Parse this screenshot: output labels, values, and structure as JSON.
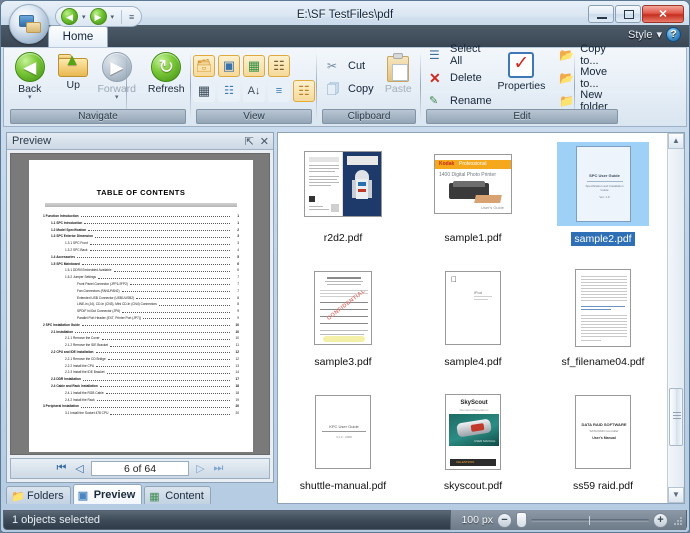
{
  "window": {
    "title": "E:\\SF TestFiles\\pdf",
    "minimize_label": "–",
    "maximize_label": "☐",
    "close_label": "✕"
  },
  "quick_access": {
    "back_icon": "back-arrow-icon",
    "forward_icon": "forward-arrow-icon",
    "dropdown_glyph": "▾",
    "more_glyph": "≡"
  },
  "ribbon": {
    "tab_label": "Home",
    "style_label": "Style",
    "style_caret": "▾",
    "help_label": "?",
    "groups": [
      {
        "name": "Navigate",
        "title": "Navigate",
        "buttons": [
          {
            "label": "Back",
            "icon": "back-arrow-icon",
            "glyph": "◀",
            "caret": "▾",
            "enabled": true
          },
          {
            "label": "Up",
            "icon": "folder-up-icon",
            "glyph": "▲",
            "caret": "",
            "enabled": true
          },
          {
            "label": "Forward",
            "icon": "forward-arrow-icon",
            "glyph": "▶",
            "caret": "▾",
            "enabled": false
          },
          {
            "label": "Refresh",
            "icon": "refresh-icon",
            "glyph": "↻",
            "caret": "",
            "enabled": true
          }
        ]
      },
      {
        "name": "View",
        "title": "View",
        "row1": [
          "view-filmstrip-icon",
          "view-thumbnails-icon",
          "view-tiles-icon",
          "view-details-grid-icon"
        ],
        "row2": [
          "view-table-icon",
          "view-list-icon",
          "view-sort-icon",
          "view-group-icon",
          "view-large-icons-icon"
        ]
      },
      {
        "name": "Clipboard",
        "title": "Clipboard",
        "cut_label": "Cut",
        "copy_label": "Copy",
        "paste_label": "Paste",
        "paste_enabled": false
      },
      {
        "name": "Edit",
        "title": "Edit",
        "select_all_label": "Select All",
        "delete_label": "Delete",
        "rename_label": "Rename",
        "properties_label": "Properties",
        "copy_to_label": "Copy to...",
        "move_to_label": "Move to...",
        "new_folder_label": "New folder"
      }
    ]
  },
  "preview": {
    "title": "Preview",
    "pin_glyph": "⇱",
    "close_glyph": "✕",
    "page_indicator": "6 of 64",
    "first_glyph": "⏮",
    "prev_glyph": "◁",
    "next_glyph": "▷",
    "last_glyph": "⏭",
    "document": {
      "heading": "TABLE OF CONTENTS",
      "entries": [
        {
          "level": 1,
          "text": "1 Function Introduction",
          "page": "1"
        },
        {
          "level": 2,
          "text": "1.1 SPC Introduction",
          "page": "1"
        },
        {
          "level": 2,
          "text": "1.2 Model Specification",
          "page": "2"
        },
        {
          "level": 2,
          "text": "1.3 SPC Exterior Dimension",
          "page": "3"
        },
        {
          "level": 3,
          "text": "1.3.1 SPC Front",
          "page": "3"
        },
        {
          "level": 3,
          "text": "1.3.2 SPC Back",
          "page": "4"
        },
        {
          "level": 2,
          "text": "1.4 Accessories",
          "page": "5"
        },
        {
          "level": 2,
          "text": "1.5 SPC Mainboard",
          "page": "6"
        },
        {
          "level": 3,
          "text": "1.5.1 DDRII Embedded Available",
          "page": "6"
        },
        {
          "level": 3,
          "text": "1.5.2 Jumper Settings",
          "page": "7"
        },
        {
          "level": 4,
          "text": "Front Panel Connector (JFP1/JFP2)",
          "page": "7"
        },
        {
          "level": 4,
          "text": "Fan Connectors (FAN1/FAN2)",
          "page": "7"
        },
        {
          "level": 4,
          "text": "Extended USB Connector (USB1/USB2)",
          "page": "8"
        },
        {
          "level": 4,
          "text": "LINE-in (J4), CD-In (CN3), Mini CD-In (CN4) Connectors",
          "page": "8"
        },
        {
          "level": 4,
          "text": "SPDIF In/Out Connector (JP6)",
          "page": "9"
        },
        {
          "level": 4,
          "text": "Parallel Port Header (EXT. Printer Port (JP7))",
          "page": "9"
        },
        {
          "level": 1,
          "text": "2 SPC Installation Guide",
          "page": "10"
        },
        {
          "level": 2,
          "text": "2.1 Installation",
          "page": "10"
        },
        {
          "level": 3,
          "text": "2.1.1 Remove the Cover",
          "page": "10"
        },
        {
          "level": 3,
          "text": "2.1.2 Remove the IDE Bracket",
          "page": "11"
        },
        {
          "level": 2,
          "text": "2.2 CPU and IDE Installation",
          "page": "12"
        },
        {
          "level": 3,
          "text": "2.2.1 Remove the CD Bridge",
          "page": "12"
        },
        {
          "level": 3,
          "text": "2.2.2 Install the CPU",
          "page": "13"
        },
        {
          "level": 3,
          "text": "2.2.3 Install the IDE Bracket",
          "page": "14"
        },
        {
          "level": 2,
          "text": "2.3 DDR Installation",
          "page": "17"
        },
        {
          "level": 2,
          "text": "2.4 Cable and Rack Installation",
          "page": "18"
        },
        {
          "level": 3,
          "text": "2.4.1 Install the RGB Cable",
          "page": "18"
        },
        {
          "level": 3,
          "text": "2.4.2 Install the Rack",
          "page": "19"
        },
        {
          "level": 1,
          "text": "3 Peripheral Installation",
          "page": "20"
        },
        {
          "level": 3,
          "text": "3.1 Install the Socket 478 CPU",
          "page": "20"
        }
      ]
    }
  },
  "left_tabs": [
    {
      "label": "Folders",
      "icon": "folders-icon",
      "active": false
    },
    {
      "label": "Preview",
      "icon": "preview-icon",
      "active": true
    },
    {
      "label": "Content",
      "icon": "content-icon",
      "active": false
    }
  ],
  "files": [
    {
      "name": "r2d2.pdf",
      "thumb": "r2d2-poster",
      "selected": false
    },
    {
      "name": "sample1.pdf",
      "thumb": "kodak-printer",
      "selected": false
    },
    {
      "name": "sample2.pdf",
      "thumb": "blue-user-guide",
      "selected": true
    },
    {
      "name": "sample3.pdf",
      "thumb": "confidential-form",
      "selected": false
    },
    {
      "name": "sample4.pdf",
      "thumb": "apple-blank",
      "selected": false
    },
    {
      "name": "sf_filename04.pdf",
      "thumb": "text-document",
      "selected": false
    },
    {
      "name": "shuttle-manual.pdf",
      "thumb": "shuttle-cover",
      "selected": false
    },
    {
      "name": "skyscout.pdf",
      "thumb": "skyscout-cover",
      "selected": false
    },
    {
      "name": "ss59 raid.pdf",
      "thumb": "raid-manual",
      "selected": false
    }
  ],
  "thumb_text": {
    "sample2_title": "SPC User Guide",
    "sample2_sub": "Specification and Installation Guide",
    "sample2_date": "Ver. 1.0",
    "shuttle_title": "KPC User Guide",
    "shuttle_sub": "V1.0 - 2008",
    "raid_title": "DATA RAID SOFTWARE",
    "raid_sub": "SATA RAID Controller",
    "raid_sub2": "User's Manual",
    "kodak_brand": "Kodak",
    "kodak_brand2": "Professional",
    "kodak_line": "1400 Digital Photo Printer",
    "kodak_guide": "User's Guide",
    "skyscout_brand": "SkyScout",
    "skyscout_sub": "Personal Planetarium",
    "skyscout_manual": "USER MANUAL",
    "skyscout_logo": "CELESTRON",
    "r2d2_title": "R2-D2",
    "confidential_stamp": "CONFIDENTIAL"
  },
  "status": {
    "text": "1 objects selected",
    "zoom_label": "100 px",
    "zoom_out": "−",
    "zoom_in": "+"
  },
  "colors": {
    "selection_blue": "#2f6fb5",
    "selection_fill": "#9fd0f5",
    "accent_green": "#6ec32f",
    "close_red": "#c52f1e"
  }
}
